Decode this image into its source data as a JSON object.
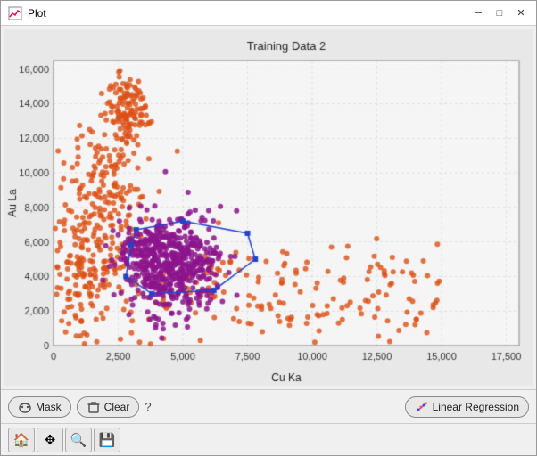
{
  "window": {
    "title": "Plot",
    "icon": "📊"
  },
  "titlebar": {
    "minimize_label": "─",
    "maximize_label": "□",
    "close_label": "✕"
  },
  "plot": {
    "title": "Training Data 2",
    "x_label": "Cu Ka",
    "y_label": "Au La",
    "x_ticks": [
      "0",
      "2500",
      "5000",
      "7500",
      "10000",
      "12500",
      "15000",
      "17500"
    ],
    "y_ticks": [
      "0",
      "2000",
      "4000",
      "6000",
      "8000",
      "10000",
      "12000",
      "14000",
      "16000"
    ]
  },
  "buttons": {
    "mask_label": "Mask",
    "clear_label": "Clear",
    "help_label": "?",
    "linear_regression_label": "Linear Regression"
  },
  "toolbar": {
    "home_icon": "🏠",
    "move_icon": "✥",
    "zoom_icon": "🔍",
    "save_icon": "💾"
  }
}
